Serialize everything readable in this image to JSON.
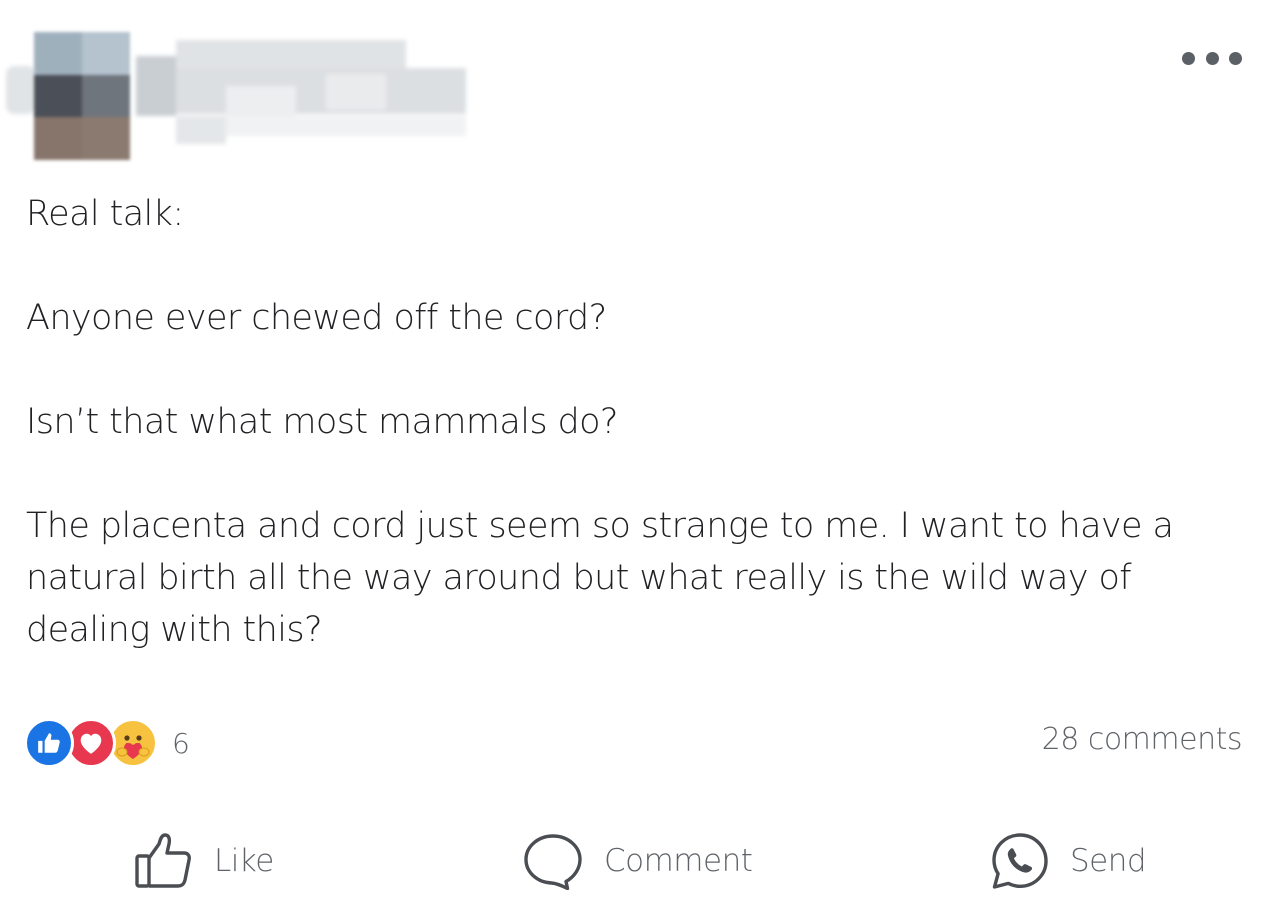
{
  "post": {
    "paragraphs": [
      "Real talk:",
      "Anyone ever chewed off the cord?",
      "Isn’t that what most mammals do?",
      "The placenta and cord just seem so strange to me. I want to have a natural birth all the way around but what really is the wild way of dealing with this?"
    ]
  },
  "reactions": {
    "types": [
      "like-icon",
      "love-icon",
      "care-icon"
    ],
    "count": "6"
  },
  "comments": {
    "count_label": "28 comments"
  },
  "actions": {
    "like_label": "Like",
    "comment_label": "Comment",
    "send_label": "Send"
  },
  "colors": {
    "like_blue": "#1b74e4",
    "love_red": "#e8384f",
    "care_yellow": "#f7c23f",
    "muted_text": "#5f6368"
  }
}
